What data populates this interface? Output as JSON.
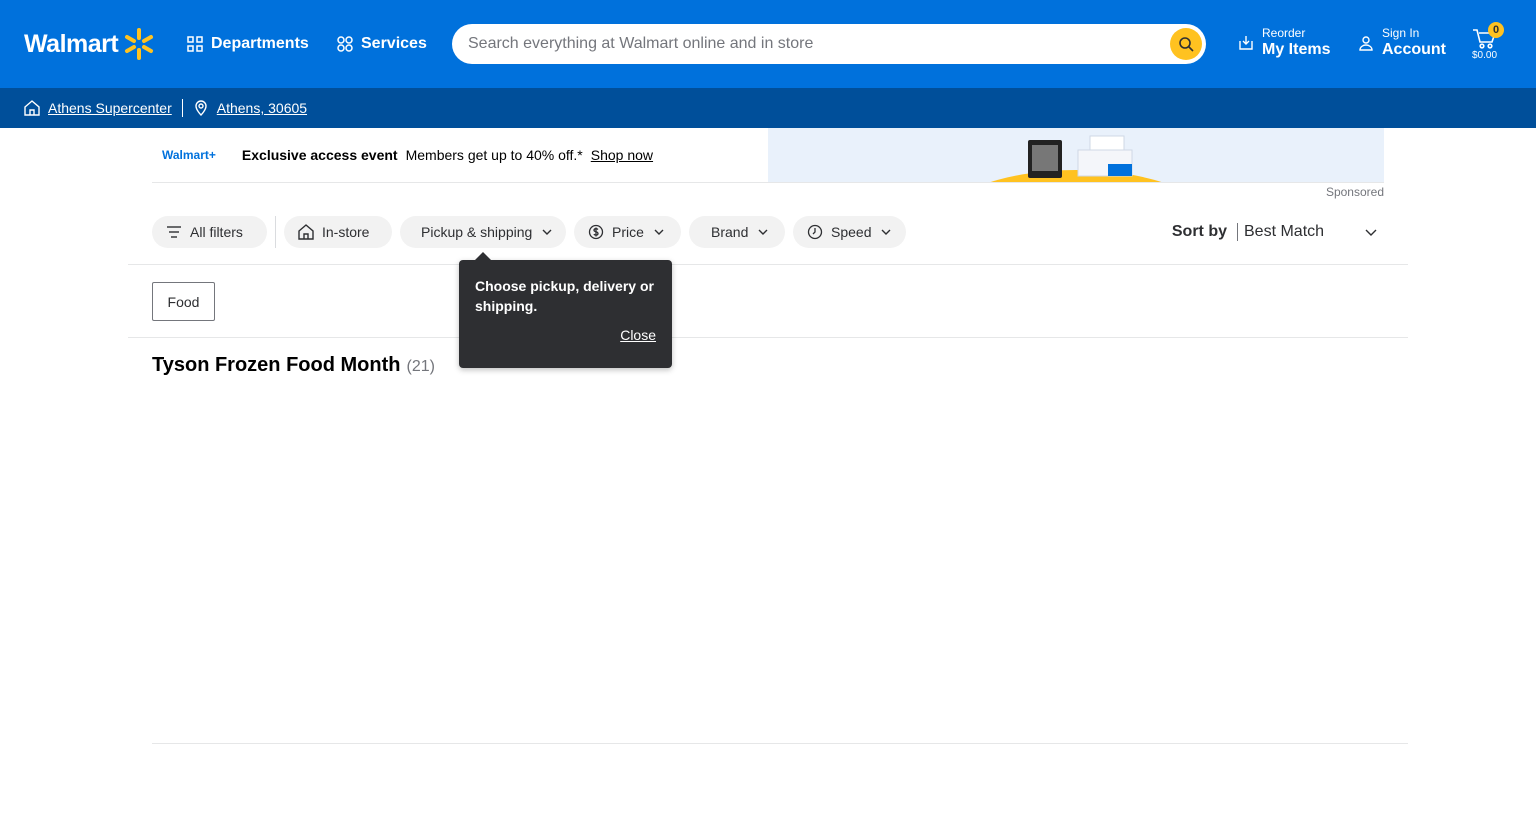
{
  "header": {
    "logo_text": "Walmart",
    "departments_label": "Departments",
    "services_label": "Services",
    "search_placeholder": "Search everything at Walmart online and in store",
    "reorder_small": "Reorder",
    "reorder_big": "My Items",
    "signin_small": "Sign In",
    "signin_big": "Account",
    "cart_count": "0",
    "cart_total": "$0.00",
    "brand_color": "#0071dc",
    "accent_color": "#ffc220"
  },
  "subbar": {
    "store": "Athens Supercenter",
    "location": "Athens, 30605"
  },
  "banner": {
    "logo_text": "Walmart+",
    "bold_text": "Exclusive access event",
    "text": "Members get up to 40% off.*",
    "link": "Shop now",
    "sponsored": "Sponsored"
  },
  "filters": {
    "all_filters": "All filters",
    "in_store": "In-store",
    "pickup": "Pickup & shipping",
    "price": "Price",
    "brand": "Brand",
    "speed": "Speed",
    "sort_label": "Sort by",
    "sort_value": "Best Match"
  },
  "chip": {
    "label": "Food"
  },
  "tooltip": {
    "text": "Choose pickup, delivery or shipping.",
    "close": "Close"
  },
  "results": {
    "title": "Tyson Frozen Food Month",
    "count": "(21)"
  }
}
